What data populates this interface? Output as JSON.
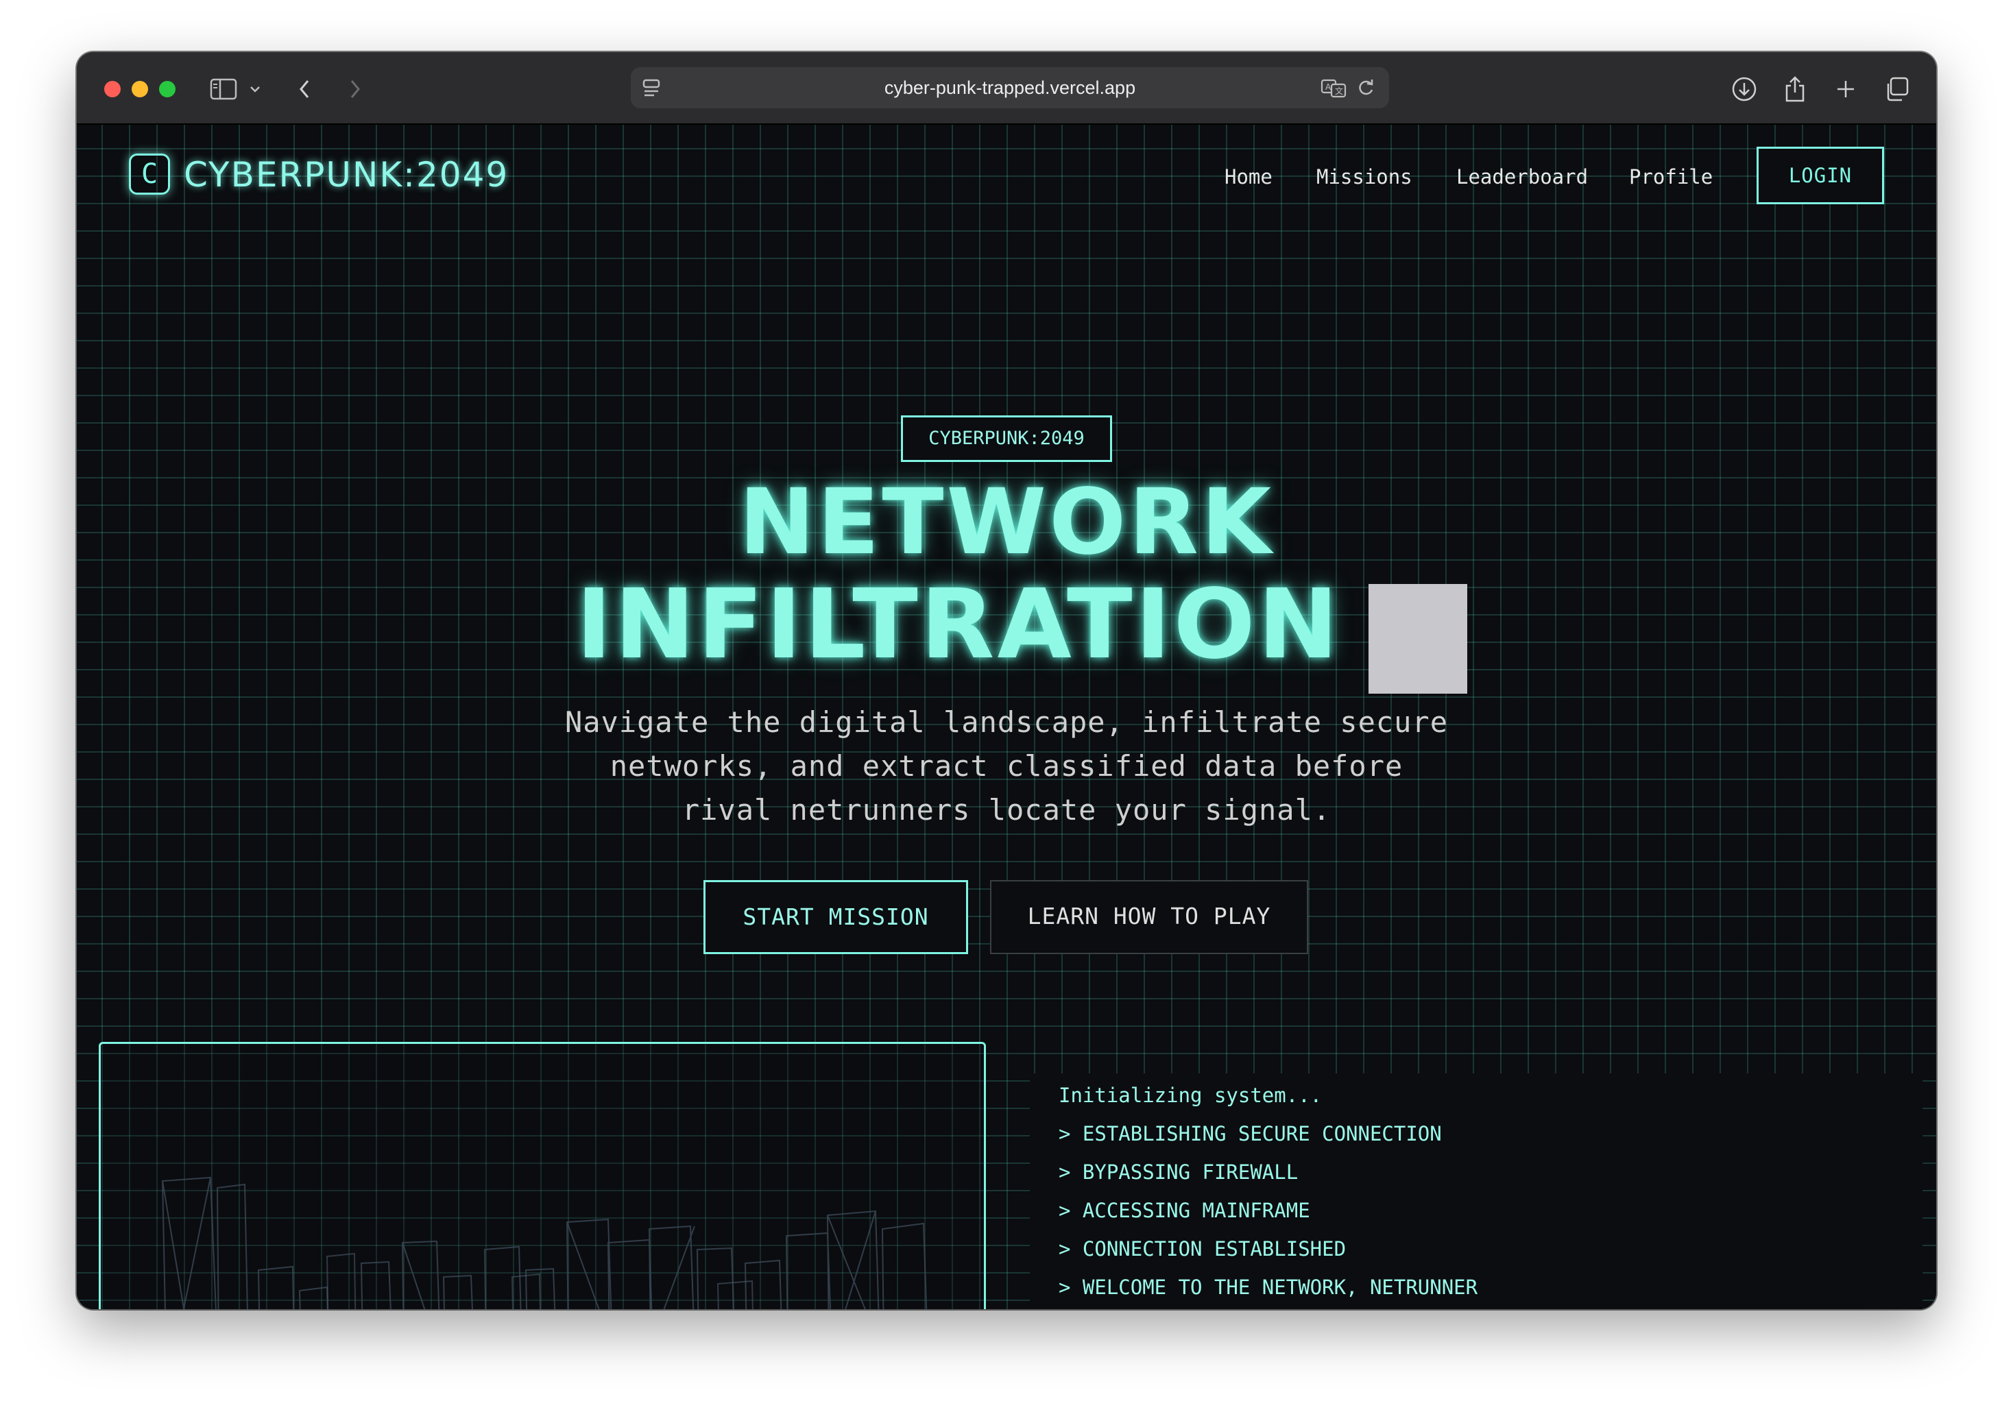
{
  "browser": {
    "url": "cyber-punk-trapped.vercel.app"
  },
  "site": {
    "logo_letter": "C",
    "logo_text": "CYBERPUNK:2049",
    "nav": [
      "Home",
      "Missions",
      "Leaderboard",
      "Profile"
    ],
    "login_label": "LOGIN"
  },
  "hero": {
    "badge": "CYBERPUNK:2049",
    "title_line1": "NETWORK",
    "title_line2": "INFILTRATION",
    "subtitle": "Navigate the digital landscape, infiltrate secure networks, and extract classified data before rival netrunners locate your signal.",
    "primary_button": "START MISSION",
    "secondary_button": "LEARN HOW TO PLAY"
  },
  "terminal": {
    "lines": [
      "Initializing system...",
      "> ESTABLISHING SECURE CONNECTION",
      "> BYPASSING FIREWALL",
      "> ACCESSING MAINFRAME",
      "> CONNECTION ESTABLISHED",
      "> WELCOME TO THE NETWORK, NETRUNNER"
    ]
  },
  "colors": {
    "accent": "#7ff5e3",
    "background": "#0b0d10",
    "cursor": "#c8c8cc"
  }
}
